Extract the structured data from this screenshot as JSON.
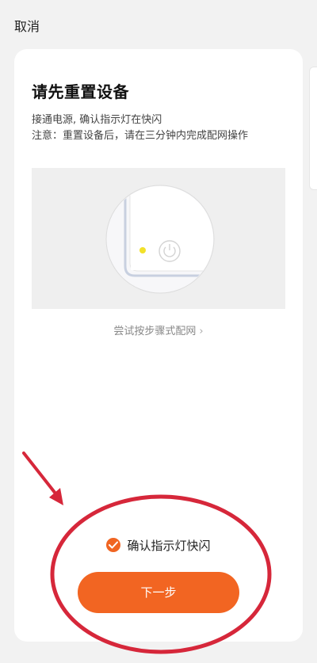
{
  "header": {
    "cancel_label": "取消"
  },
  "card": {
    "title": "请先重置设备",
    "desc_line1": "接通电源, 确认指示灯在快闪",
    "desc_line2": "注意：重置设备后，请在三分钟内完成配网操作",
    "try_link_label": "尝试按步骤式配网",
    "try_link_chevron": "›",
    "confirm_label": "确认指示灯快闪",
    "confirm_checked": true,
    "next_button_label": "下一步"
  },
  "colors": {
    "accent": "#f26522",
    "annotation": "#d6273a",
    "indicator_light": "#f2e12a"
  },
  "icons": {
    "confirm_checkbox": "checkmark-icon",
    "power": "power-icon",
    "chevron": "chevron-right-icon"
  }
}
